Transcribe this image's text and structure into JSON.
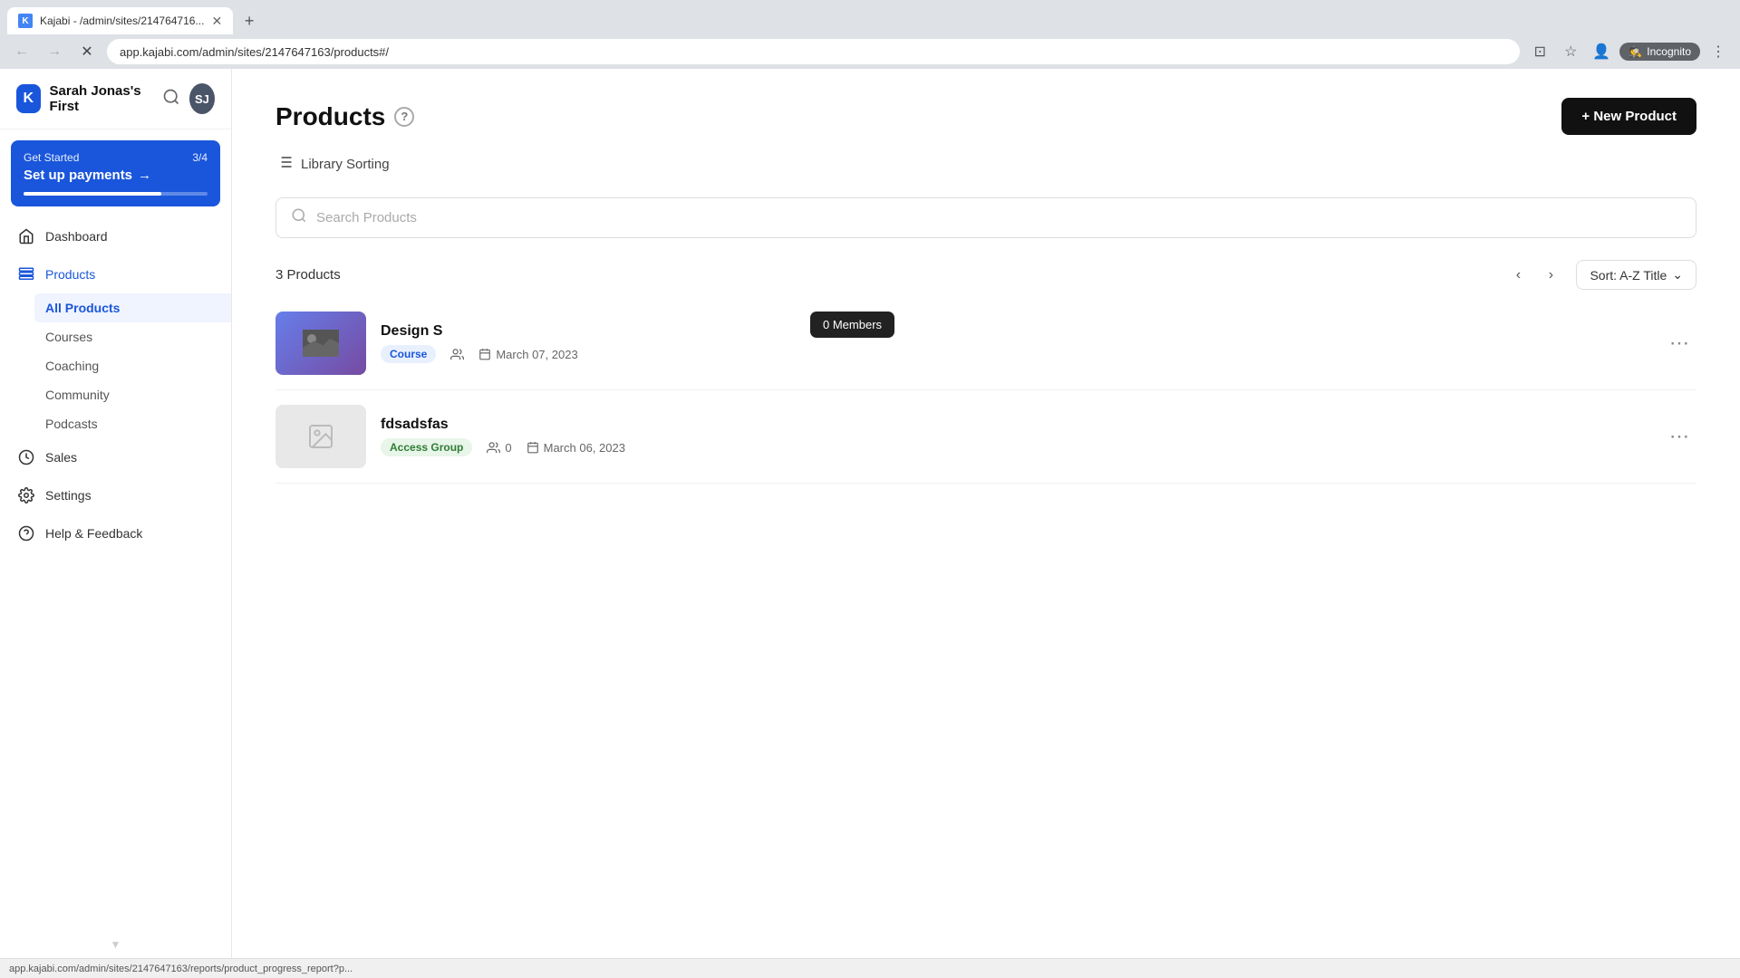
{
  "browser": {
    "tab_title": "Kajabi - /admin/sites/214764716...",
    "url": "app.kajabi.com/admin/sites/2147647163/products#/",
    "incognito_label": "Incognito"
  },
  "sidebar": {
    "brand": "Sarah Jonas's First",
    "get_started": {
      "label": "Get Started",
      "count": "3/4",
      "action": "Set up payments",
      "arrow": "→"
    },
    "nav_items": [
      {
        "id": "dashboard",
        "label": "Dashboard"
      },
      {
        "id": "products",
        "label": "Products",
        "active": true
      },
      {
        "id": "sales",
        "label": "Sales"
      },
      {
        "id": "settings",
        "label": "Settings"
      },
      {
        "id": "help",
        "label": "Help & Feedback"
      }
    ],
    "products_sub": [
      {
        "id": "all-products",
        "label": "All Products",
        "active": true
      },
      {
        "id": "courses",
        "label": "Courses"
      },
      {
        "id": "coaching",
        "label": "Coaching"
      },
      {
        "id": "community",
        "label": "Community"
      },
      {
        "id": "podcasts",
        "label": "Podcasts"
      }
    ]
  },
  "main": {
    "page_title": "Products",
    "new_product_btn": "+ New Product",
    "library_sorting": "Library Sorting",
    "search_placeholder": "Search Products",
    "products_count": "3 Products",
    "sort_label": "Sort: A-Z Title",
    "products": [
      {
        "id": "design-s",
        "name": "Design S",
        "badge": "Course",
        "badge_type": "course",
        "members": "0 Members",
        "date": "March 07, 2023",
        "has_thumb": true
      },
      {
        "id": "fdsadsfas",
        "name": "fdsadsfas",
        "badge": "Access Group",
        "badge_type": "access",
        "members": "0",
        "date": "March 06, 2023",
        "has_thumb": false
      }
    ],
    "tooltip": "0 Members"
  },
  "status_bar": {
    "text": "app.kajabi.com/admin/sites/2147647163/reports/product_progress_report?p..."
  },
  "avatar": {
    "initials": "SJ"
  }
}
